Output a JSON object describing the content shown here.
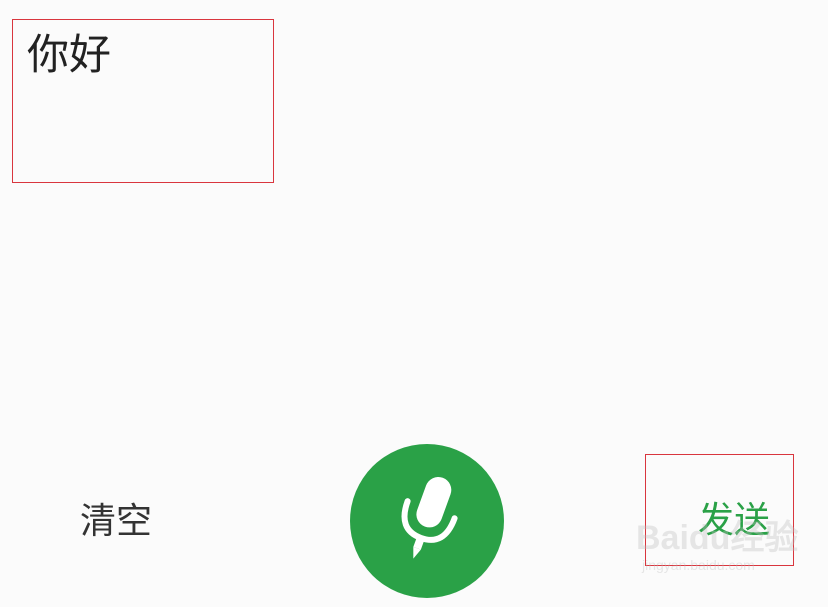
{
  "input_area": {
    "text": "你好"
  },
  "actions": {
    "clear_label": "清空",
    "send_label": "发送",
    "mic_icon": "microphone-icon"
  },
  "watermark": {
    "main": "Baidu经验",
    "sub": "jingyan.baidu.com"
  },
  "colors": {
    "accent": "#2aa147",
    "highlight_border": "#d9363e",
    "background": "#fbfbfb"
  }
}
